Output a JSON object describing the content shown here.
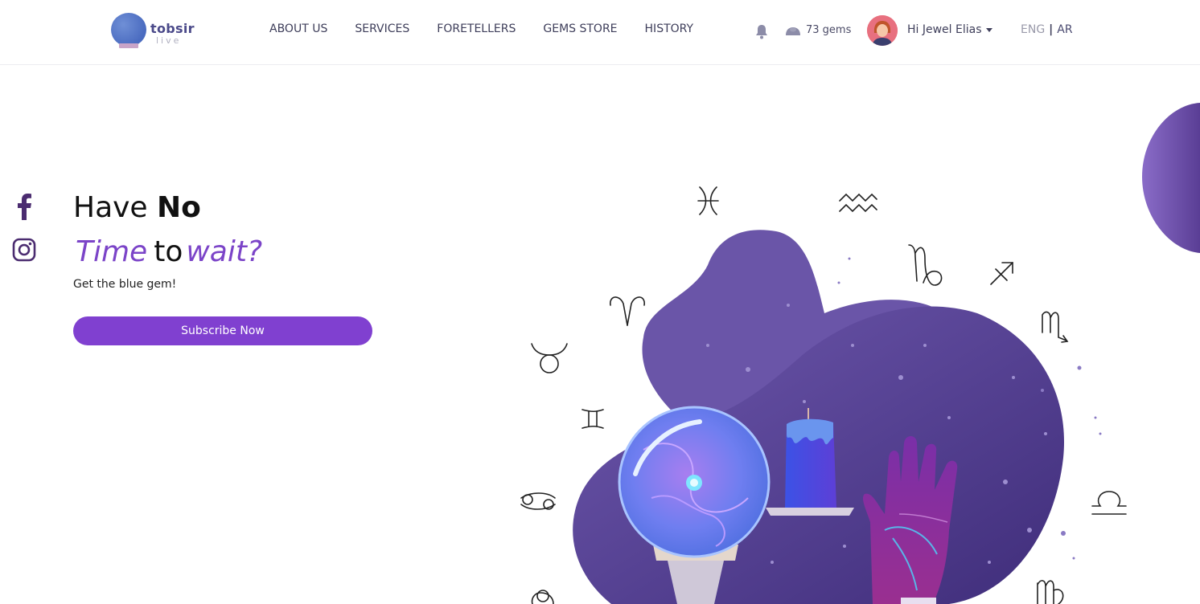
{
  "header": {
    "logo_text": "tobsir",
    "logo_sub": "live",
    "nav": [
      "ABOUT US",
      "SERVICES",
      "FORETELLERS",
      "GEMS STORE",
      "HISTORY"
    ],
    "gems": "73 gems",
    "user_greeting": "Hi Jewel Elias",
    "lang_eng": "ENG",
    "lang_sep": "|",
    "lang_ar": "AR"
  },
  "hero": {
    "line1_a": "Have",
    "line1_b": "No",
    "line2_a": "Time",
    "line2_b": "to",
    "line2_c": "wait?",
    "tagline": "Get the blue gem!",
    "button": "Subscribe Now"
  },
  "social": [
    "facebook-icon",
    "instagram-icon"
  ],
  "colors": {
    "accent": "#8040d0",
    "blob_dark": "#4f3a8c",
    "blob_light": "#6a55a8",
    "nav_text": "#3e3e5a"
  },
  "zodiac_icons": [
    "pisces-icon",
    "aquarius-icon",
    "capricorn-icon",
    "sagittarius-icon",
    "scorpio-icon",
    "aries-icon",
    "taurus-icon",
    "gemini-icon",
    "cancer-icon",
    "libra-icon",
    "leo-icon",
    "virgo-icon"
  ]
}
